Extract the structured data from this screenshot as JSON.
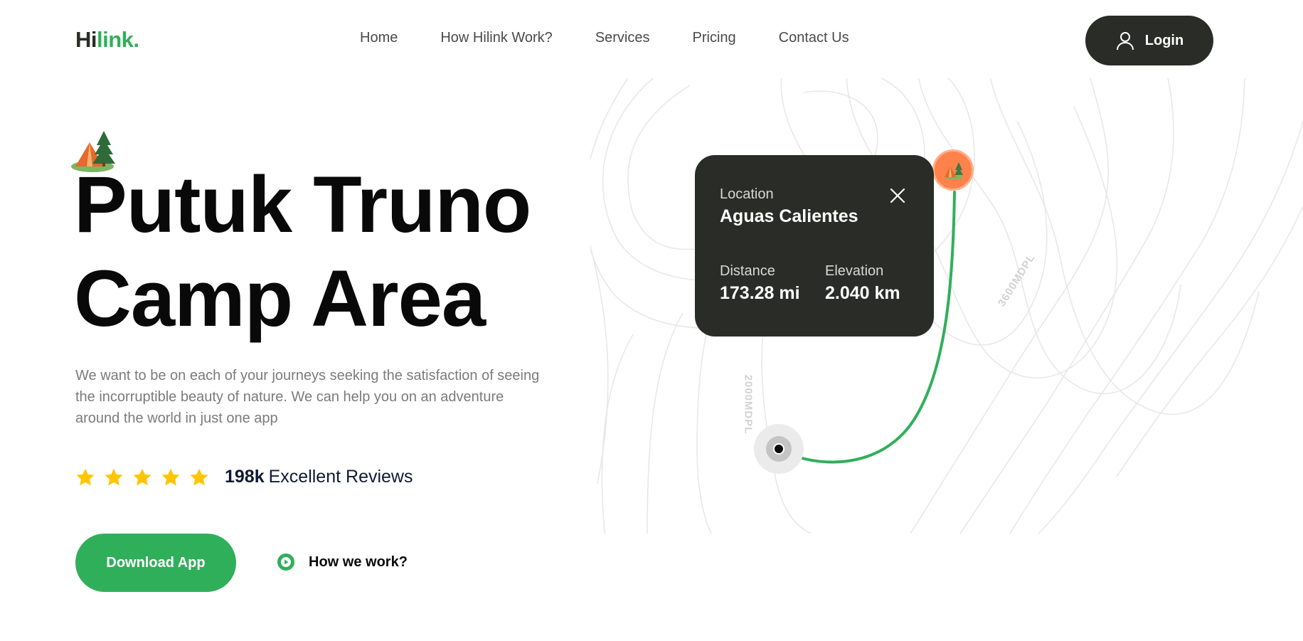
{
  "header": {
    "logo_part1": "Hi",
    "logo_part2": "link.",
    "nav": [
      "Home",
      "How Hilink Work?",
      "Services",
      "Pricing",
      "Contact Us"
    ],
    "login_label": "Login"
  },
  "hero": {
    "title_line1": "Putuk Truno",
    "title_line2": "Camp Area",
    "description": "We want to be on each of your journeys seeking the satisfaction of seeing the incorruptible beauty of nature. We can help you on an adventure around the world in just one app",
    "rating": {
      "stars": 5,
      "count": "198k",
      "text": "Excellent Reviews"
    },
    "download_label": "Download App",
    "how_label": "How we work?"
  },
  "map_card": {
    "location_label": "Location",
    "location_value": "Aguas Calientes",
    "distance_label": "Distance",
    "distance_value": "173.28 mi",
    "elevation_label": "Elevation",
    "elevation_value": "2.040 km"
  },
  "map": {
    "topo_label_1": "3600MDPL",
    "topo_label_2": "2000MDPL"
  },
  "colors": {
    "green": "#30af5b",
    "dark": "#292c27",
    "orange": "#ff814c",
    "star": "#fec601"
  }
}
